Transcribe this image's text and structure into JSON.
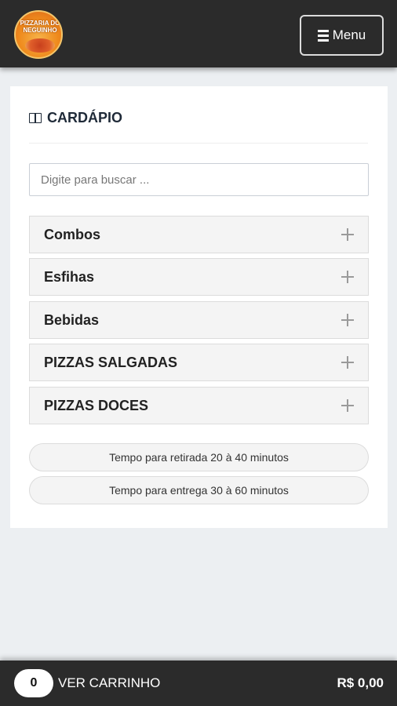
{
  "header": {
    "logo_text": "PIZZARIA DO NEGUINHO",
    "menu_label": "Menu",
    "menu_icon": "hamburger-icon"
  },
  "menu_card": {
    "title": "CARDÁPIO",
    "title_icon": "book-icon",
    "search": {
      "placeholder": "Digite para buscar ...",
      "value": ""
    },
    "categories": [
      {
        "label": "Combos",
        "icon": "plus-icon"
      },
      {
        "label": "Esfihas",
        "icon": "plus-icon"
      },
      {
        "label": "Bebidas",
        "icon": "plus-icon"
      },
      {
        "label": "PIZZAS SALGADAS",
        "icon": "plus-icon"
      },
      {
        "label": "PIZZAS DOCES",
        "icon": "plus-icon"
      }
    ],
    "info": [
      "Tempo para retirada 20 à 40 minutos",
      "Tempo para entrega 30 à 60 minutos"
    ]
  },
  "cart_bar": {
    "count": "0",
    "label": "VER CARRINHO",
    "total": "R$ 0,00"
  },
  "colors": {
    "bar_background": "#2b2b2b",
    "page_background": "#eceff2",
    "category_background": "#f4f4f4",
    "title_color": "#1f2a38"
  }
}
